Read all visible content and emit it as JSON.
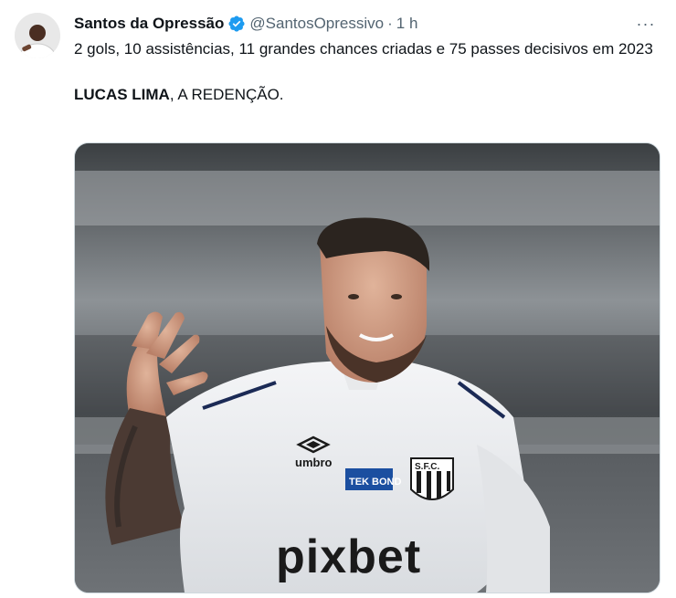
{
  "tweet": {
    "author": {
      "display_name": "Santos da Opressão",
      "handle": "@SantosOpressivo",
      "verified_icon": "verified-badge-icon",
      "avatar_icon": "avatar"
    },
    "separator": "·",
    "timestamp": "1 h",
    "more_icon": "more-options-icon",
    "more_glyph": "···",
    "text": {
      "line1": "2 gols, 10 assistências, 11 grandes chances criadas e 75 passes decisivos em 2023",
      "highlight": "LUCAS LIMA",
      "rest": ", A REDENÇÃO."
    },
    "media": {
      "shirt_texts": {
        "kit_brand": "umbro",
        "sponsor_sleeve": "TEK BOND",
        "crest": "S.F.C.",
        "main_sponsor": "pixbet"
      }
    }
  },
  "colors": {
    "verified": "#1d9bf0",
    "text": "#0f1419",
    "secondary": "#536471",
    "border": "#cfd9de"
  }
}
